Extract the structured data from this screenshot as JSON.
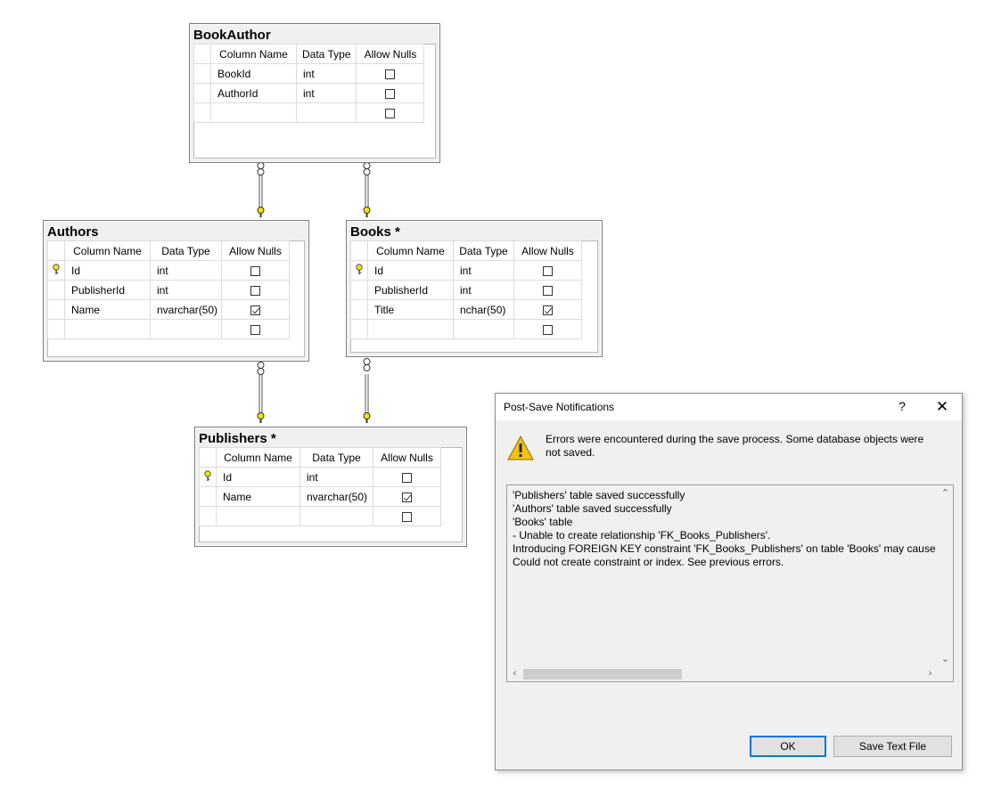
{
  "tables": {
    "bookauthor": {
      "name": "BookAuthor",
      "headers": [
        "Column Name",
        "Data Type",
        "Allow Nulls"
      ],
      "rows": [
        {
          "column": "BookId",
          "type": "int",
          "nulls": false
        },
        {
          "column": "AuthorId",
          "type": "int",
          "nulls": false
        }
      ]
    },
    "authors": {
      "name": "Authors",
      "headers": [
        "Column Name",
        "Data Type",
        "Allow Nulls"
      ],
      "rows": [
        {
          "column": "Id",
          "type": "int",
          "nulls": false,
          "key": true
        },
        {
          "column": "PublisherId",
          "type": "int",
          "nulls": false
        },
        {
          "column": "Name",
          "type": "nvarchar(50)",
          "nulls": true
        }
      ]
    },
    "books": {
      "name": "Books *",
      "headers": [
        "Column Name",
        "Data Type",
        "Allow Nulls"
      ],
      "rows": [
        {
          "column": "Id",
          "type": "int",
          "nulls": false,
          "key": true
        },
        {
          "column": "PublisherId",
          "type": "int",
          "nulls": false
        },
        {
          "column": "Title",
          "type": "nchar(50)",
          "nulls": true
        }
      ]
    },
    "publishers": {
      "name": "Publishers *",
      "headers": [
        "Column Name",
        "Data Type",
        "Allow Nulls"
      ],
      "rows": [
        {
          "column": "Id",
          "type": "int",
          "nulls": false,
          "key": true
        },
        {
          "column": "Name",
          "type": "nvarchar(50)",
          "nulls": true
        }
      ]
    }
  },
  "dialog": {
    "title": "Post-Save Notifications",
    "help_label": "?",
    "close_label": "✕",
    "message": "Errors were encountered during the save process. Some database objects were not saved.",
    "log_lines": [
      "'Publishers' table saved successfully",
      "'Authors' table saved successfully",
      "'Books' table",
      "- Unable to create relationship 'FK_Books_Publishers'.",
      "Introducing FOREIGN KEY constraint 'FK_Books_Publishers' on table 'Books' may cause cy",
      "Could not create constraint or index. See previous errors."
    ],
    "ok_label": "OK",
    "save_label": "Save Text File"
  },
  "colors": {
    "key": "#f2e600",
    "accent": "#0078d7",
    "warning": "#f4c20d"
  },
  "icons": [
    "key-icon",
    "warning-icon",
    "help-icon",
    "close-icon",
    "checkbox-icon",
    "relationship-link-icon"
  ]
}
